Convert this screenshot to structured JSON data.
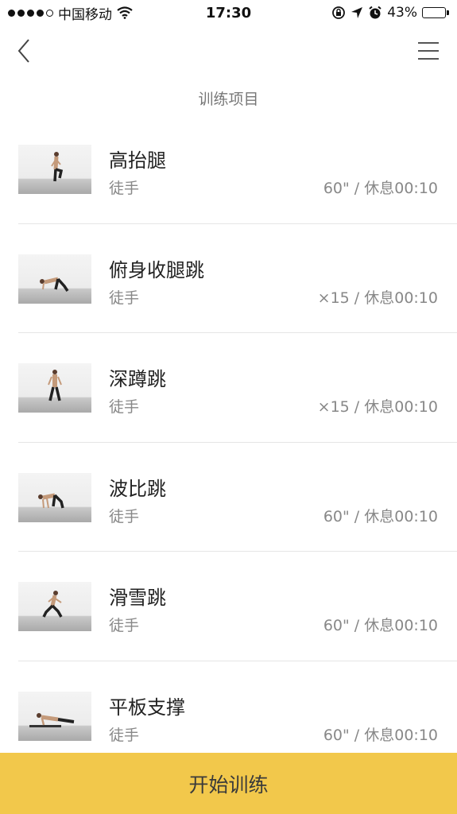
{
  "status_bar": {
    "carrier": "中国移动",
    "time": "17:30",
    "battery_percent": "43%",
    "battery_level": 0.43,
    "icons": [
      "signal-dots-icon",
      "wifi-icon",
      "rotation-lock-icon",
      "location-arrow-icon",
      "alarm-icon",
      "battery-icon"
    ]
  },
  "nav": {
    "back_icon": "chevron-left-icon",
    "menu_icon": "hamburger-menu-icon"
  },
  "section_title": "训练项目",
  "items": [
    {
      "name": "高抬腿",
      "equipment": "徒手",
      "detail": "60\" / 休息00:10",
      "thumb_icon": "exercise-thumbnail"
    },
    {
      "name": "俯身收腿跳",
      "equipment": "徒手",
      "detail": "×15 / 休息00:10",
      "thumb_icon": "exercise-thumbnail"
    },
    {
      "name": "深蹲跳",
      "equipment": "徒手",
      "detail": "×15 / 休息00:10",
      "thumb_icon": "exercise-thumbnail"
    },
    {
      "name": "波比跳",
      "equipment": "徒手",
      "detail": "60\" / 休息00:10",
      "thumb_icon": "exercise-thumbnail"
    },
    {
      "name": "滑雪跳",
      "equipment": "徒手",
      "detail": "60\" / 休息00:10",
      "thumb_icon": "exercise-thumbnail"
    },
    {
      "name": "平板支撑",
      "equipment": "徒手",
      "detail": "60\" / 休息00:10",
      "thumb_icon": "exercise-thumbnail"
    }
  ],
  "start_button": {
    "label": "开始训练",
    "color": "#f2c84b"
  }
}
